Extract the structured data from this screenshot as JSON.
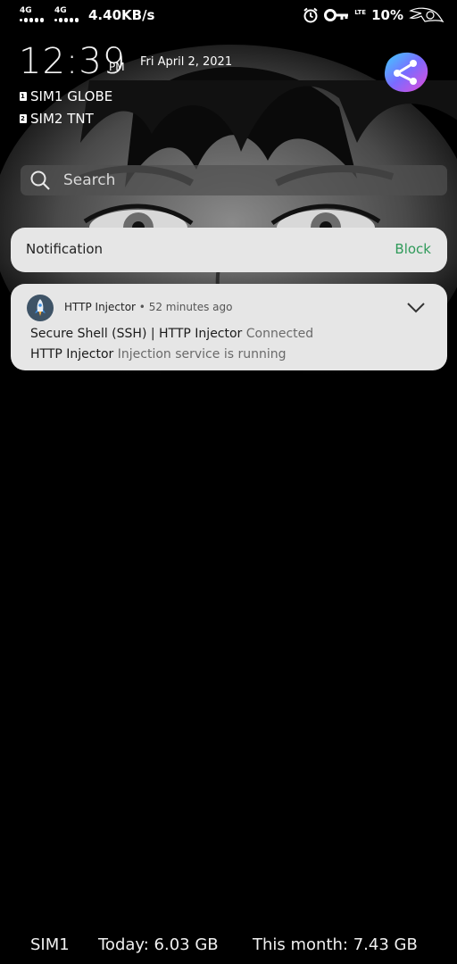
{
  "status_bar": {
    "sim1_network": "4G",
    "sim2_network": "4G",
    "net_speed": "4.40KB/s",
    "alarm_icon": "alarm-clock-icon",
    "vpn_icon": "key-icon",
    "lte_label": "LTE",
    "battery": "10%"
  },
  "lockscreen": {
    "time": "12:39",
    "ampm": "PM",
    "date": "Fri April 2, 2021",
    "sim1_badge": "1",
    "sim1_label": "SIM1 GLOBE",
    "sim2_badge": "2",
    "sim2_label": "SIM2 TNT"
  },
  "search": {
    "placeholder": "Search"
  },
  "notification_header": {
    "title": "Notification",
    "action": "Block"
  },
  "notification": {
    "app_name": "HTTP Injector",
    "separator": " • ",
    "time_ago": "52 minutes ago",
    "line1_bold": "Secure Shell (SSH) | HTTP Injector",
    "line1_muted": " Connected",
    "line2_bold": "HTTP Injector",
    "line2_muted": " Injection service is running"
  },
  "data_usage": {
    "sim": "SIM1",
    "today": "Today: 6.03 GB",
    "month": "This month: 7.43 GB"
  },
  "colors": {
    "block_green": "#2f9a5a",
    "card_bg": "#e6e6e6",
    "app_icon_bg": "#3e5366"
  }
}
